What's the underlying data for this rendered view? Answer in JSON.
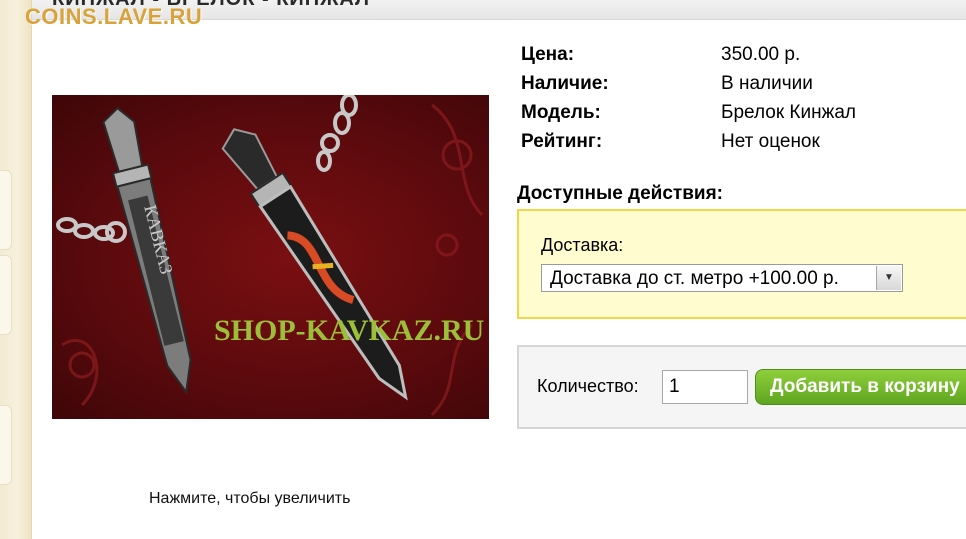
{
  "watermark": "COINS.LAVE.RU",
  "header": {
    "title": "КИНЖАЛ - БРЕЛОК - КИНЖАЛ"
  },
  "image": {
    "shop_text": "SHOP-KAVKAZ.RU",
    "blade_text": "КАВКАЗ",
    "caption": "Нажмите, чтобы увеличить"
  },
  "details": {
    "price_label": "Цена:",
    "price_value": "350.00 р.",
    "stock_label": "Наличие:",
    "stock_value": "В наличии",
    "model_label": "Модель:",
    "model_value": "Брелок Кинжал",
    "rating_label": "Рейтинг:",
    "rating_value": "Нет оценок"
  },
  "actions": {
    "title": "Доступные действия:",
    "delivery_label": "Доставка:",
    "delivery_selected": "Доставка до ст. метро +100.00 р."
  },
  "cart": {
    "quantity_label": "Количество:",
    "quantity_value": "1",
    "add_button": "Добавить в корзину"
  },
  "colors": {
    "accent_green": "#6cb52a",
    "options_bg": "#fffdcf",
    "options_border": "#f3d54a",
    "watermark": "#d9a23a"
  }
}
